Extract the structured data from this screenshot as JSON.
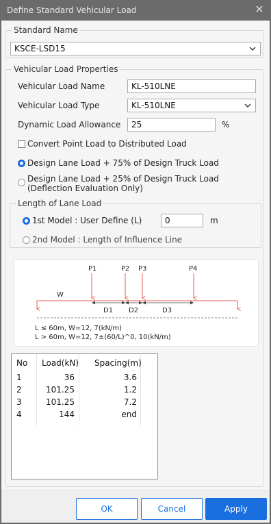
{
  "window": {
    "title": "Define Standard Vehicular Load",
    "close_glyph": "✕"
  },
  "standard_name": {
    "legend": "Standard Name",
    "value": "KSCE-LSD15"
  },
  "vehicular": {
    "legend": "Vehicular Load Properties",
    "name_label": "Vehicular Load Name",
    "name_value": "KL-510LNE",
    "type_label": "Vehicular Load Type",
    "type_value": "KL-510LNE",
    "dla_label": "Dynamic Load Allowance",
    "dla_value": "25",
    "dla_unit": "%",
    "convert_label": "Convert Point Load to Distributed Load",
    "convert_checked": false,
    "design_option_1": "Design Lane Load + 75% of Design Truck Load",
    "design_option_2_line1": "Design Lane Load + 25% of Design Truck Load",
    "design_option_2_line2": "(Deflection Evaluation Only)",
    "design_selected": 1
  },
  "lane": {
    "legend": "Length of Lane Load",
    "model1_label": "1st Model : User Define (L)",
    "model1_value": "0",
    "model1_unit": "m",
    "model2_label": "2nd Model : Length of  Influence Line",
    "selected": 1
  },
  "diagram": {
    "loads": [
      "P1",
      "P2",
      "P3",
      "P4"
    ],
    "distributed_label": "W",
    "spacings": [
      "D1",
      "D2",
      "D3"
    ],
    "note1": "L ≤ 60m, W=12, 7(kN/m)",
    "note2": "L > 60m, W=12, 7±(60/L)^0, 10(kN/m)",
    "load_color": "#e8584e"
  },
  "table": {
    "headers": [
      "No",
      "Load(kN)",
      "Spacing(m)"
    ],
    "rows": [
      {
        "no": "1",
        "load": "36",
        "spacing": "3.6"
      },
      {
        "no": "2",
        "load": "101.25",
        "spacing": "1.2"
      },
      {
        "no": "3",
        "load": "101.25",
        "spacing": "7.2"
      },
      {
        "no": "4",
        "load": "144",
        "spacing": "end"
      }
    ]
  },
  "buttons": {
    "ok": "OK",
    "cancel": "Cancel",
    "apply": "Apply"
  },
  "colors": {
    "accent": "#1a6fe0",
    "titlebar": "#6b6b6b"
  }
}
